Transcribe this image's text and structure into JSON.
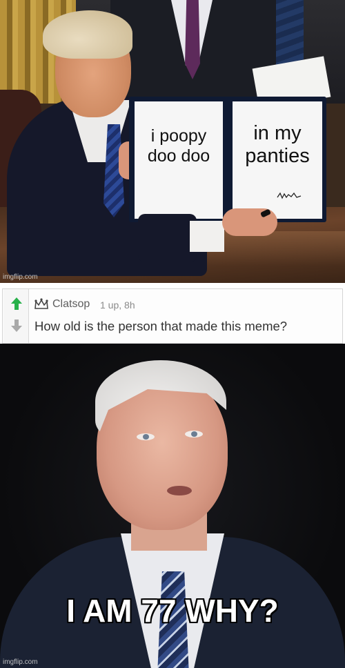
{
  "panel_top": {
    "left_page_text": "i poopy doo doo",
    "right_page_text": "in my panties",
    "watermark": "imgflip.com"
  },
  "comment": {
    "username": "Clatsop",
    "meta": "1 up, 8h",
    "text": "How old is the person that made this meme?",
    "upvote_icon": "arrow-up-icon",
    "downvote_icon": "arrow-down-icon",
    "accent_upvote": "#27b14a"
  },
  "panel_bottom": {
    "caption": "I AM 77 WHY?",
    "watermark": "imgflip.com"
  }
}
